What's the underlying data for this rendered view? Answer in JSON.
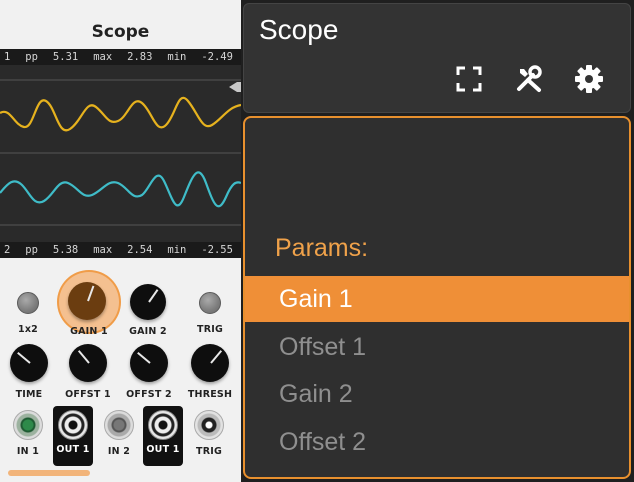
{
  "module": {
    "title": "Scope",
    "readout_top": {
      "channel": "1",
      "pp_label": "pp",
      "pp_value": "5.31",
      "max_label": "max",
      "max_value": "2.83",
      "min_label": "min",
      "min_value": "-2.49"
    },
    "readout_bottom": {
      "channel": "2",
      "pp_label": "pp",
      "pp_value": "5.38",
      "max_label": "max",
      "max_value": "2.54",
      "min_label": "min",
      "min_value": "-2.55"
    },
    "trace_colors": {
      "channel1": "#e6b21e",
      "channel2": "#3fbcc8"
    },
    "labels": {
      "x2": "1x2",
      "gain1": "GAIN 1",
      "gain2": "GAIN 2",
      "trig_led": "TRIG",
      "time": "TIME",
      "offset1": "OFFST 1",
      "offset2": "OFFST 2",
      "thresh": "THRESH",
      "in1": "IN 1",
      "out1": "OUT 1",
      "in2": "IN 2",
      "out2": "OUT 1",
      "trig": "TRIG"
    }
  },
  "menu": {
    "title": "Scope",
    "section": "Params:",
    "items": [
      "Gain 1",
      "Offset 1",
      "Gain 2",
      "Offset 2"
    ],
    "selected_item": "Gain 1",
    "accent_color": "#ef8f37",
    "icons": [
      "fullscreen-icon",
      "tools-icon",
      "gear-icon"
    ]
  }
}
